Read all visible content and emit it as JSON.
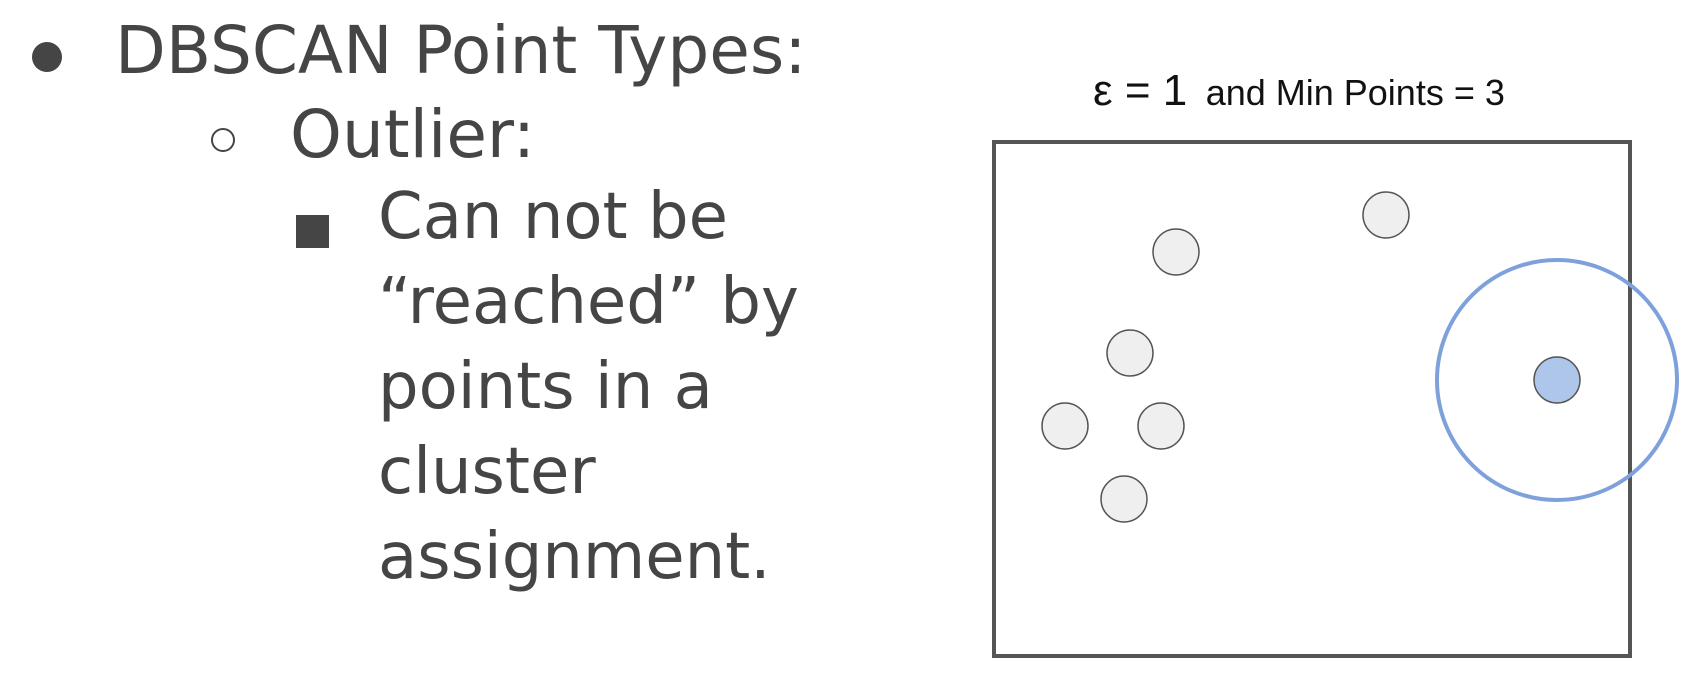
{
  "slide": {
    "heading": "DBSCAN Point Types:",
    "subheading": "Outlier:",
    "body_lines": [
      "Can not be",
      "“reached” by",
      "points in a",
      "cluster",
      "assignment."
    ]
  },
  "diagram": {
    "label_epsilon": "ε = 1",
    "label_rest": "and  Min Points = 3",
    "colors": {
      "frame": "#555555",
      "point_fill": "#efefef",
      "point_stroke": "#555555",
      "highlight_fill": "#aec6ea",
      "radius_circle": "#7ea1dc",
      "text": "#454545"
    },
    "points": [
      {
        "id": "p1",
        "type": "regular"
      },
      {
        "id": "p2",
        "type": "regular"
      },
      {
        "id": "p3",
        "type": "regular"
      },
      {
        "id": "p4",
        "type": "regular"
      },
      {
        "id": "p5",
        "type": "regular"
      },
      {
        "id": "p6",
        "type": "regular"
      },
      {
        "id": "p7",
        "type": "regular"
      },
      {
        "id": "outlier",
        "type": "outlier"
      }
    ]
  }
}
